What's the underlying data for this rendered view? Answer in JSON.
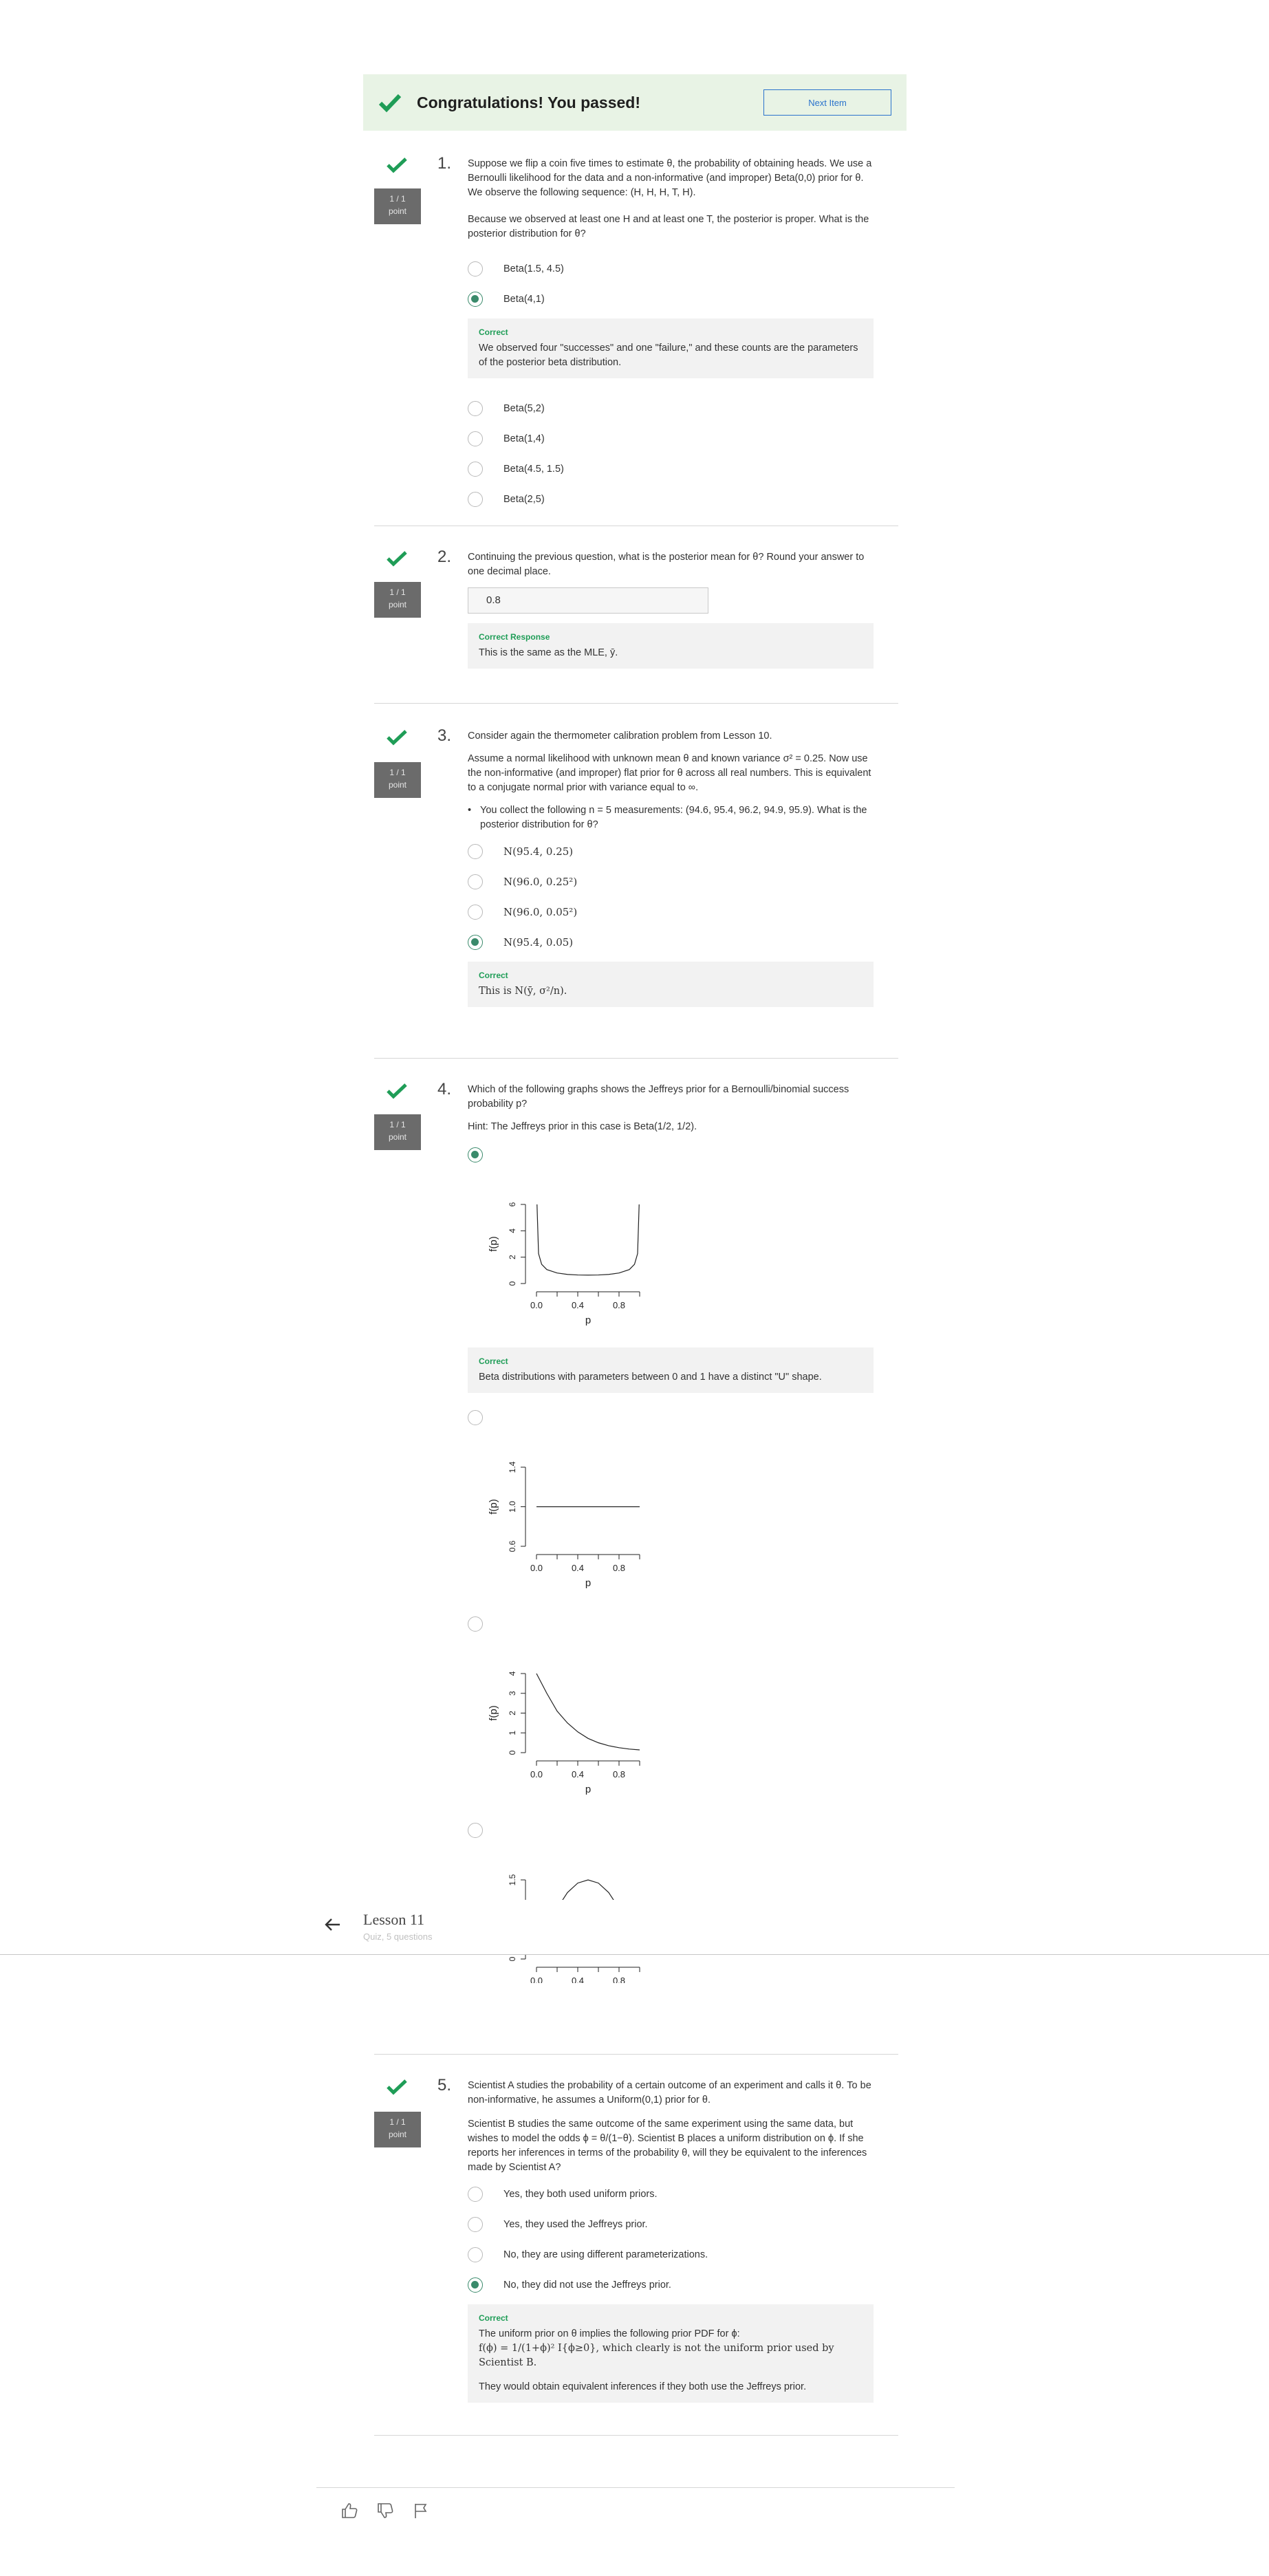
{
  "banner": {
    "title": "Congratulations! You passed!",
    "next_label": "Next Item"
  },
  "lesson": {
    "title": "Lesson 11",
    "subtitle": "Quiz, 5 questions"
  },
  "questions": [
    {
      "number": "1.",
      "points": [
        "1 / 1",
        "point"
      ],
      "prompt": [
        "Suppose we flip a coin five times to estimate θ, the probability of obtaining heads. We use a Bernoulli likelihood for the data and a non-informative (and improper) Beta(0,0) prior for θ. We observe the following sequence: (H, H, H, T, H).",
        "Because we observed at least one H and at least one T, the posterior is proper. What is the posterior distribution for θ?"
      ],
      "options": [
        "Beta(1.5, 4.5)",
        "Beta(4,1)",
        "Beta(5,2)",
        "Beta(1,4)",
        "Beta(4.5, 1.5)",
        "Beta(2,5)"
      ],
      "selected_index": 1,
      "feedback": {
        "title": "Correct",
        "text": "We observed four \"successes\" and one \"failure,\" and these counts are the parameters of the posterior beta distribution."
      }
    },
    {
      "number": "2.",
      "points": [
        "1 / 1",
        "point"
      ],
      "prompt": [
        "Continuing the previous question, what is the posterior mean for θ? Round your answer to one decimal place."
      ],
      "answer_value": "0.8",
      "feedback": {
        "title": "Correct Response",
        "text": "This is the same as the MLE, ȳ."
      }
    },
    {
      "number": "3.",
      "points": [
        "1 / 1",
        "point"
      ],
      "prompt": [
        "Consider again the thermometer calibration problem from Lesson 10.",
        "Assume a normal likelihood with unknown mean θ and known variance σ² = 0.25. Now use the non-informative (and improper) flat prior for θ across all real numbers. This is equivalent to a conjugate normal prior with variance equal to ∞."
      ],
      "bullet": "You collect the following n = 5 measurements: (94.6, 95.4, 96.2, 94.9, 95.9). What is the posterior distribution for θ?",
      "options": [
        "N(95.4, 0.25)",
        "N(96.0, 0.25²)",
        "N(96.0, 0.05²)",
        "N(95.4, 0.05)"
      ],
      "selected_index": 3,
      "feedback": {
        "title": "Correct",
        "text": "This is N(ȳ, σ²/n)."
      }
    },
    {
      "number": "4.",
      "points": [
        "1 / 1",
        "point"
      ],
      "prompt": [
        "Which of the following graphs shows the Jeffreys prior for a Bernoulli/binomial success probability p?",
        "Hint: The Jeffreys prior in this case is Beta(1/2, 1/2)."
      ],
      "selected_index": 0,
      "feedback": {
        "title": "Correct",
        "text": "Beta distributions with parameters between 0 and 1 have a distinct \"U\" shape."
      }
    },
    {
      "number": "5.",
      "points": [
        "1 / 1",
        "point"
      ],
      "prompt": [
        "Scientist A studies the probability of a certain outcome of an experiment and calls it θ. To be non-informative, he assumes a Uniform(0,1) prior for θ.",
        "Scientist B studies the same outcome of the same experiment using the same data, but wishes to model the odds ϕ = θ/(1−θ). Scientist B places a uniform distribution on ϕ. If she reports her inferences in terms of the probability θ, will they be equivalent to the inferences made by Scientist A?"
      ],
      "options": [
        "Yes, they both used uniform priors.",
        "Yes, they used the Jeffreys prior.",
        "No, they are using different parameterizations.",
        "No, they did not use the Jeffreys prior."
      ],
      "selected_index": 3,
      "feedback": {
        "title": "Correct",
        "text1": "The uniform prior on θ implies the following prior PDF for ϕ:",
        "text2": "f(ϕ) = 1/(1+ϕ)² I{ϕ≥0}, which clearly is not the uniform prior used by Scientist B.",
        "text3": "They would obtain equivalent inferences if they both use the Jeffreys prior."
      }
    }
  ],
  "chart_data": [
    {
      "type": "line",
      "name": "Beta(1/2,1/2) density",
      "xlabel": "p",
      "ylabel": "f(p)",
      "xlim": [
        0,
        1
      ],
      "ylim": [
        0,
        6
      ],
      "xticks": [
        "0.0",
        "0.4",
        "0.8"
      ],
      "yticks": [
        "0",
        "2",
        "4",
        "6"
      ],
      "x": [
        0.005,
        0.02,
        0.05,
        0.1,
        0.2,
        0.3,
        0.4,
        0.5,
        0.6,
        0.7,
        0.8,
        0.9,
        0.95,
        0.98,
        0.995
      ],
      "y": [
        6.0,
        2.27,
        1.46,
        1.06,
        0.8,
        0.69,
        0.65,
        0.64,
        0.65,
        0.69,
        0.8,
        1.06,
        1.46,
        2.27,
        6.0
      ]
    },
    {
      "type": "line",
      "name": "Uniform density",
      "xlabel": "p",
      "ylabel": "f(p)",
      "xlim": [
        0,
        1
      ],
      "ylim": [
        0.6,
        1.4
      ],
      "xticks": [
        "0.0",
        "0.4",
        "0.8"
      ],
      "yticks": [
        "0.6",
        "1.0",
        "1.4"
      ],
      "x": [
        0,
        1
      ],
      "y": [
        1.0,
        1.0
      ]
    },
    {
      "type": "line",
      "name": "Decreasing density",
      "xlabel": "p",
      "ylabel": "f(p)",
      "xlim": [
        0,
        1
      ],
      "ylim": [
        0,
        4
      ],
      "xticks": [
        "0.0",
        "0.4",
        "0.8"
      ],
      "yticks": [
        "0",
        "1",
        "2",
        "3",
        "4"
      ],
      "x": [
        0.0,
        0.1,
        0.2,
        0.3,
        0.4,
        0.5,
        0.6,
        0.7,
        0.8,
        0.9,
        1.0
      ],
      "y": [
        4.0,
        3.0,
        2.1,
        1.5,
        1.05,
        0.72,
        0.5,
        0.35,
        0.25,
        0.18,
        0.14
      ]
    },
    {
      "type": "line",
      "name": "Hump density",
      "xlabel": "p",
      "ylabel": "",
      "xlim": [
        0,
        1
      ],
      "ylim": [
        0,
        1.5
      ],
      "xticks": [
        "0.0",
        "0.4",
        "0.8"
      ],
      "yticks": [
        "0",
        "1.5"
      ],
      "x": [
        0.1,
        0.2,
        0.3,
        0.4,
        0.5,
        0.6,
        0.7,
        0.8,
        0.9
      ],
      "y": [
        0.54,
        0.96,
        1.26,
        1.44,
        1.5,
        1.44,
        1.26,
        0.96,
        0.54
      ]
    }
  ],
  "footer": {
    "icons": [
      "thumbs-up-icon",
      "thumbs-down-icon",
      "flag-icon"
    ]
  }
}
